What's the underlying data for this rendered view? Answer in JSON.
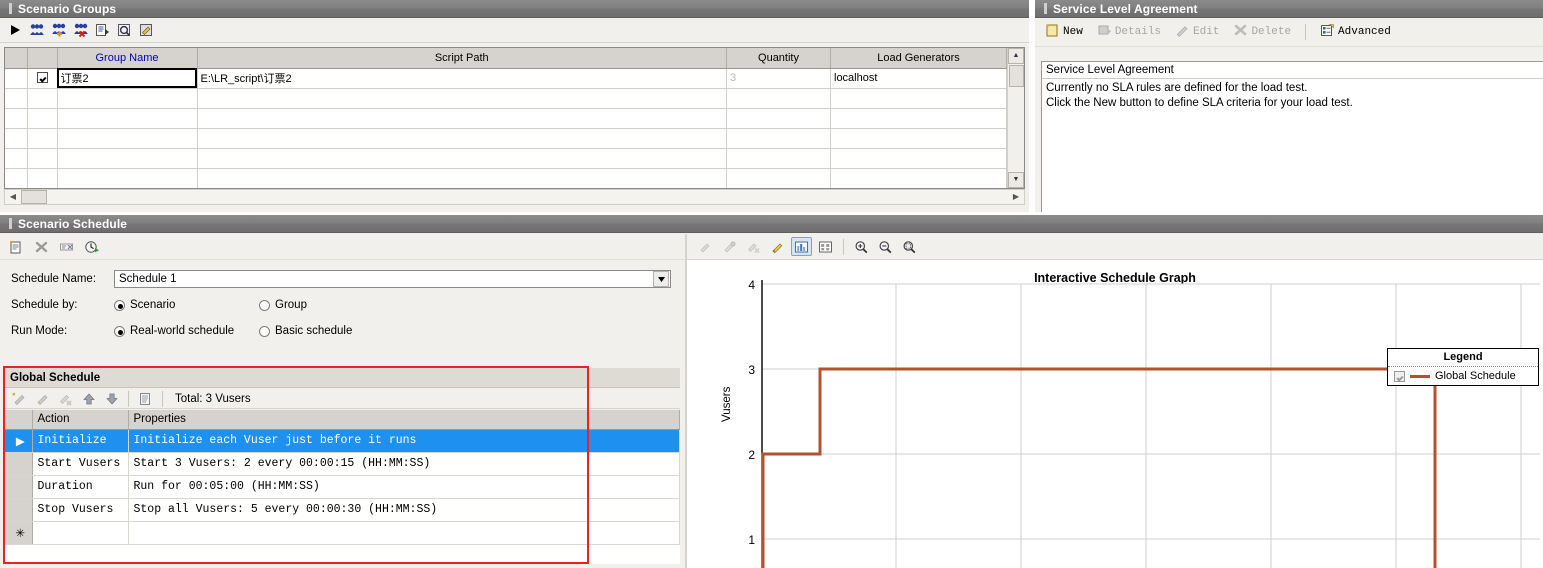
{
  "scenario_groups": {
    "title": "Scenario Groups",
    "toolbar": [
      {
        "name": "start-scenario-icon",
        "glyph": "▶"
      },
      {
        "name": "vusers-icon",
        "glyph": "###"
      },
      {
        "name": "add-group-icon",
        "glyph": "###"
      },
      {
        "name": "remove-group-icon",
        "glyph": "###"
      },
      {
        "name": "details-icon",
        "glyph": "▤"
      },
      {
        "name": "view-script-icon",
        "glyph": "⌕"
      },
      {
        "name": "edit-script-icon",
        "glyph": "✎"
      }
    ],
    "columns": [
      "",
      "",
      "Group Name",
      "Script Path",
      "Quantity",
      "Load Generators"
    ],
    "rows": [
      {
        "checked": true,
        "group_name": "订票2",
        "script_path": "E:\\LR_script\\订票2",
        "quantity": "3",
        "load_generators": "localhost"
      }
    ],
    "empty_row_count": 6
  },
  "sla": {
    "title": "Service Level Agreement",
    "toolbar": [
      {
        "label": "New",
        "icon": "new-sla-icon",
        "enabled": true
      },
      {
        "label": "Details",
        "icon": "details-icon",
        "enabled": false
      },
      {
        "label": "Edit",
        "icon": "edit-pencil-icon",
        "enabled": false
      },
      {
        "label": "Delete",
        "icon": "delete-x-icon",
        "enabled": false
      },
      {
        "label": "Advanced",
        "icon": "advanced-icon",
        "enabled": true
      }
    ],
    "box_header": "Service Level Agreement",
    "box_lines": [
      "Currently no SLA rules are defined for the load test.",
      "Click the New button to define SLA criteria for your load test."
    ]
  },
  "scenario_schedule": {
    "title": "Scenario Schedule",
    "toolbar": [
      {
        "name": "new-schedule-icon",
        "glyph": "▤"
      },
      {
        "name": "delete-schedule-icon",
        "glyph": "✕"
      },
      {
        "name": "rename-schedule-icon",
        "glyph": "▭"
      },
      {
        "name": "schedule-clock-icon",
        "glyph": "◷"
      }
    ],
    "schedule_name_label": "Schedule Name:",
    "schedule_name_value": "Schedule 1",
    "schedule_by_label": "Schedule by:",
    "schedule_by_options": [
      "Scenario",
      "Group"
    ],
    "schedule_by_selected": "Scenario",
    "run_mode_label": "Run Mode:",
    "run_mode_options": [
      "Real-world schedule",
      "Basic schedule"
    ],
    "run_mode_selected": "Real-world schedule",
    "global_schedule": {
      "header": "Global Schedule",
      "toolbar": [
        {
          "name": "add-action-icon",
          "glyph": "✎"
        },
        {
          "name": "edit-action-icon",
          "glyph": "✎"
        },
        {
          "name": "delete-action-icon",
          "glyph": "✎"
        },
        {
          "name": "move-up-icon",
          "glyph": "⬆"
        },
        {
          "name": "move-down-icon",
          "glyph": "⬇"
        },
        {
          "name": "copy-icon",
          "glyph": "▤"
        }
      ],
      "total_label": "Total: 3 Vusers",
      "columns": [
        "",
        "Action",
        "Properties"
      ],
      "rows": [
        {
          "action": "Initialize",
          "properties": "Initialize each Vuser just before it runs",
          "selected": true
        },
        {
          "action": "Start  Vusers",
          "properties": "Start 3 Vusers: 2 every 00:00:15  (HH:MM:SS)",
          "selected": false
        },
        {
          "action": "Duration",
          "properties": "Run for 00:05:00  (HH:MM:SS)",
          "selected": false
        },
        {
          "action": "Stop Vusers",
          "properties": "Stop all Vusers: 5 every 00:00:30  (HH:MM:SS)",
          "selected": false
        },
        {
          "action": "",
          "properties": "",
          "selected": false,
          "new_row": true
        }
      ]
    }
  },
  "graph_panel": {
    "toolbar": [
      {
        "name": "add-point-icon",
        "glyph": "●",
        "enabled": false,
        "selected": false
      },
      {
        "name": "edit-point-icon",
        "glyph": "●",
        "enabled": false,
        "selected": false
      },
      {
        "name": "delete-point-icon",
        "glyph": "●",
        "enabled": false,
        "selected": false
      },
      {
        "name": "pencil-edit-icon",
        "glyph": "✎",
        "enabled": true,
        "selected": false
      },
      {
        "name": "show-graph-icon",
        "glyph": "▥",
        "enabled": true,
        "selected": true
      },
      {
        "name": "fit-graph-icon",
        "glyph": "▣",
        "enabled": true,
        "selected": false
      },
      {
        "name": "zoom-in-icon",
        "glyph": "⊕",
        "enabled": true,
        "selected": false
      },
      {
        "name": "zoom-out-icon",
        "glyph": "⊖",
        "enabled": true,
        "selected": false
      },
      {
        "name": "zoom-reset-icon",
        "glyph": "⊙",
        "enabled": true,
        "selected": false
      }
    ],
    "legend_title": "Legend",
    "legend_entries": [
      {
        "label": "Global Schedule",
        "color": "#b5512e",
        "checked": true
      }
    ]
  },
  "chart_data": {
    "type": "line",
    "title": "Interactive Schedule Graph",
    "xlabel": "",
    "ylabel": "Vusers",
    "ylim": [
      0,
      4
    ],
    "yticks": [
      1,
      2,
      3,
      4
    ],
    "xlim": [
      0,
      6
    ],
    "grid": true,
    "legend_position": "top-right",
    "line_color": "#b5512e",
    "series": [
      {
        "name": "Global Schedule",
        "step": true,
        "points": [
          {
            "x": 0.0,
            "y": 0
          },
          {
            "x": 0.0,
            "y": 2
          },
          {
            "x": 0.55,
            "y": 2
          },
          {
            "x": 0.55,
            "y": 3
          },
          {
            "x": 5.35,
            "y": 3
          },
          {
            "x": 5.35,
            "y": 0
          }
        ]
      }
    ]
  }
}
